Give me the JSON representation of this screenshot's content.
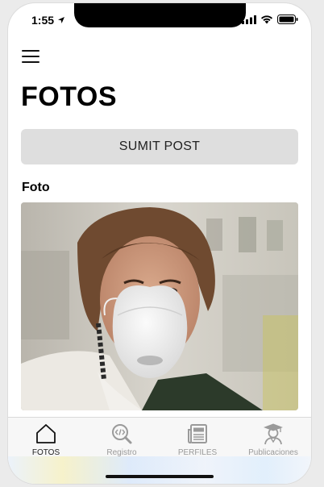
{
  "status_bar": {
    "time": "1:55"
  },
  "header": {
    "title": "FOTOS"
  },
  "actions": {
    "submit_label": "SUMIT POST"
  },
  "post": {
    "section_label": "Foto"
  },
  "tabbar": {
    "tabs": [
      {
        "label": "FOTOS",
        "icon": "home-icon",
        "active": true
      },
      {
        "label": "Registro",
        "icon": "code-search-icon",
        "active": false
      },
      {
        "label": "PERFILES",
        "icon": "newspaper-icon",
        "active": false
      },
      {
        "label": "Publicaciones",
        "icon": "graduate-icon",
        "active": false
      }
    ]
  }
}
